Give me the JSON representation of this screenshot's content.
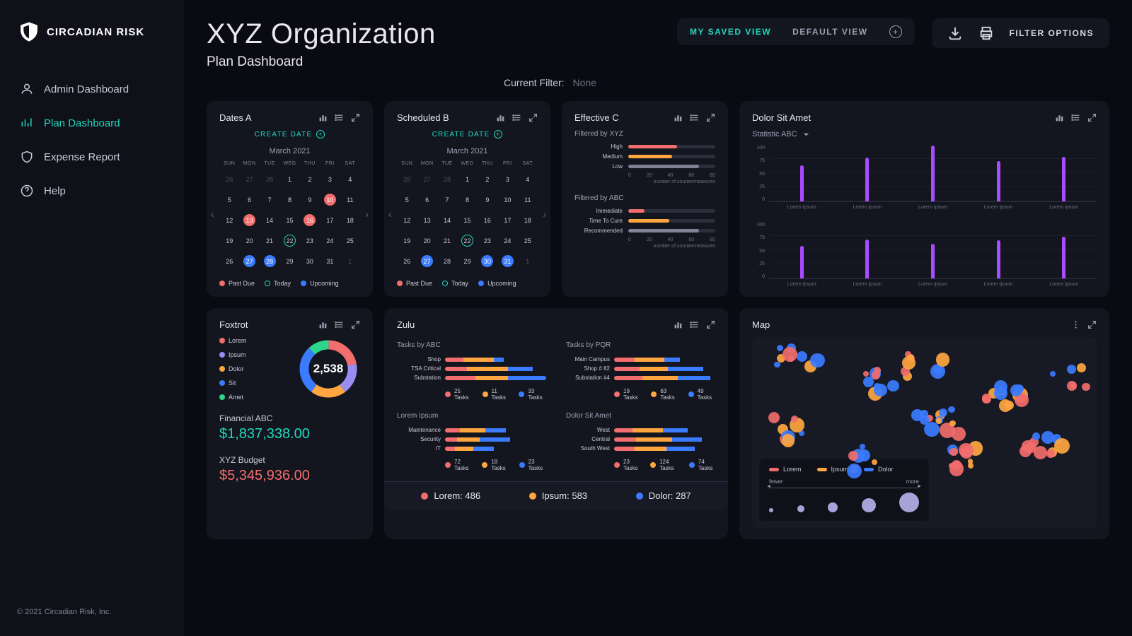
{
  "brand": {
    "name": "CIRCADIAN RISK",
    "copyright": "© 2021 Circadian Risk, Inc."
  },
  "sidebar": {
    "items": [
      {
        "label": "Admin Dashboard",
        "icon": "user-icon"
      },
      {
        "label": "Plan Dashboard",
        "icon": "bars-icon",
        "active": true
      },
      {
        "label": "Expense Report",
        "icon": "shield-icon"
      },
      {
        "label": "Help",
        "icon": "question-icon"
      }
    ]
  },
  "header": {
    "title": "XYZ Organization",
    "subtitle": "Plan Dashboard",
    "view_tabs": [
      "MY SAVED VIEW",
      "DEFAULT VIEW"
    ],
    "filter_options": "FILTER OPTIONS",
    "current_filter_label": "Current Filter:",
    "current_filter_value": "None"
  },
  "cards": {
    "datesA": {
      "title": "Dates A",
      "create": "CREATE DATE",
      "month": "March 2021",
      "dow": [
        "SUN",
        "MON",
        "TUE",
        "WED",
        "THU",
        "FRI",
        "SAT"
      ],
      "legend": {
        "pastdue": "Past Due",
        "today": "Today",
        "upcoming": "Upcoming"
      }
    },
    "scheduledB": {
      "title": "Scheduled B",
      "create": "CREATE DATE",
      "month": "March 2021"
    },
    "effectiveC": {
      "title": "Effective C",
      "section1_label": "Filtered by XYZ",
      "section2_label": "Filtered by ABC",
      "axis_label": "number of countermeasures"
    },
    "dolor": {
      "title": "Dolor Sit Amet",
      "dropdown": "Statistic ABC"
    },
    "foxtrot": {
      "title": "Foxtrot",
      "legend": [
        "Lorem",
        "Ipsum",
        "Dolor",
        "Sit",
        "Amet"
      ],
      "center_value": "2,538",
      "fin1_label": "Financial ABC",
      "fin1_value": "$1,837,338.00",
      "fin2_label": "XYZ Budget",
      "fin2_value": "$5,345,936.00"
    },
    "zulu": {
      "title": "Zulu",
      "sections": {
        "tasks_abc": {
          "label": "Tasks by ABC",
          "legend": [
            "25 Tasks",
            "11 Tasks",
            "33 Tasks"
          ]
        },
        "tasks_pqr": {
          "label": "Tasks by PQR",
          "legend": [
            "19 Tasks",
            "63 Tasks",
            "49 Tasks"
          ]
        },
        "lorem": {
          "label": "Lorem Ipsum",
          "legend": [
            "72 Tasks",
            "18 Tasks",
            "23 Tasks"
          ]
        },
        "dolor": {
          "label": "Dolor Sit Amet",
          "legend": [
            "23 Tasks",
            "124 Tasks",
            "74 Tasks"
          ]
        }
      },
      "footer": {
        "lorem": "Lorem: 486",
        "ipsum": "Ipsum: 583",
        "dolor": "Dolor: 287"
      }
    },
    "map": {
      "title": "Map",
      "legend": [
        "Lorem",
        "Ipsum",
        "Dolor"
      ],
      "scale": {
        "fewer": "fewer",
        "more": "more"
      }
    }
  },
  "colors": {
    "teal": "#1fd8c0",
    "red": "#f26d6d",
    "blue": "#3a7bff",
    "orange": "#ffa640",
    "purple": "#a94bff",
    "grey": "#7f8294",
    "green": "#2dd68a",
    "violet": "#9b8cf0"
  },
  "chart_data": {
    "effectiveC_xyz": {
      "type": "bar",
      "orientation": "horizontal",
      "categories": [
        "High",
        "Medium",
        "Low"
      ],
      "values": [
        45,
        40,
        65
      ],
      "colors": [
        "#f26d6d",
        "#ffa640",
        "#7f8294"
      ],
      "xlim": [
        0,
        80
      ],
      "xticks": [
        0,
        20,
        40,
        60,
        80
      ],
      "xlabel": "number of countermeasures"
    },
    "effectiveC_abc": {
      "type": "bar",
      "orientation": "horizontal",
      "categories": [
        "Immediate",
        "Time To Cure",
        "Recommended"
      ],
      "values": [
        15,
        38,
        65
      ],
      "colors": [
        "#f26d6d",
        "#ffa640",
        "#7f8294"
      ],
      "xlim": [
        0,
        80
      ],
      "xticks": [
        0,
        20,
        40,
        60,
        80
      ],
      "xlabel": "number of countermeasures"
    },
    "dolor_top": {
      "type": "bar",
      "categories": [
        "Lorem Ipsum",
        "Lorem Ipsum",
        "Lorem Ipsum",
        "Lorem Ipsum",
        "Lorem Ipsum"
      ],
      "values": [
        65,
        78,
        100,
        72,
        80
      ],
      "ylim": [
        0,
        100
      ],
      "yticks": [
        0,
        25,
        50,
        75,
        100
      ],
      "color": "#a94bff"
    },
    "dolor_bottom": {
      "type": "bar",
      "categories": [
        "Lorem Ipsum",
        "Lorem Ipsum",
        "Lorem Ipsum",
        "Lorem Ipsum",
        "Lorem Ipsum"
      ],
      "values": [
        58,
        70,
        62,
        68,
        75
      ],
      "ylim": [
        0,
        100
      ],
      "yticks": [
        0,
        25,
        50,
        75,
        100
      ],
      "color": "#a94bff"
    },
    "foxtrot_donut": {
      "type": "pie",
      "series": [
        {
          "name": "Lorem",
          "value": 22,
          "color": "#f26d6d"
        },
        {
          "name": "Ipsum",
          "value": 18,
          "color": "#9b8cf0"
        },
        {
          "name": "Dolor",
          "value": 20,
          "color": "#ffa640"
        },
        {
          "name": "Sit",
          "value": 28,
          "color": "#3a7bff"
        },
        {
          "name": "Amet",
          "value": 12,
          "color": "#2dd68a"
        }
      ],
      "center_value": "2,538"
    },
    "zulu_tasks_abc": {
      "type": "bar",
      "stacked": true,
      "categories": [
        "Shop",
        "TSA Critical",
        "Substation"
      ],
      "series": [
        {
          "name": "25 Tasks",
          "color": "#f26d6d",
          "values": [
            18,
            22,
            30
          ]
        },
        {
          "name": "11 Tasks",
          "color": "#ffa640",
          "values": [
            30,
            40,
            32
          ]
        },
        {
          "name": "33 Tasks",
          "color": "#3a7bff",
          "values": [
            10,
            25,
            38
          ]
        }
      ]
    },
    "zulu_tasks_pqr": {
      "type": "bar",
      "stacked": true,
      "categories": [
        "Main Campus",
        "Shop # 82",
        "Substation #4"
      ],
      "series": [
        {
          "name": "19 Tasks",
          "color": "#f26d6d",
          "values": [
            20,
            25,
            28
          ]
        },
        {
          "name": "63 Tasks",
          "color": "#ffa640",
          "values": [
            30,
            28,
            35
          ]
        },
        {
          "name": "49 Tasks",
          "color": "#3a7bff",
          "values": [
            15,
            35,
            32
          ]
        }
      ]
    },
    "zulu_lorem": {
      "type": "bar",
      "stacked": true,
      "categories": [
        "Maintenance",
        "Security",
        "IT"
      ],
      "series": [
        {
          "name": "72 Tasks",
          "color": "#f26d6d",
          "values": [
            15,
            12,
            10
          ]
        },
        {
          "name": "18 Tasks",
          "color": "#ffa640",
          "values": [
            25,
            22,
            18
          ]
        },
        {
          "name": "23 Tasks",
          "color": "#3a7bff",
          "values": [
            20,
            30,
            20
          ]
        }
      ]
    },
    "zulu_dolor": {
      "type": "bar",
      "stacked": true,
      "categories": [
        "West",
        "Central",
        "South West"
      ],
      "series": [
        {
          "name": "23 Tasks",
          "color": "#f26d6d",
          "values": [
            18,
            22,
            20
          ]
        },
        {
          "name": "124 Tasks",
          "color": "#ffa640",
          "values": [
            30,
            35,
            32
          ]
        },
        {
          "name": "74 Tasks",
          "color": "#3a7bff",
          "values": [
            25,
            30,
            28
          ]
        }
      ]
    },
    "zulu_totals": {
      "Lorem": 486,
      "Ipsum": 583,
      "Dolor": 287
    }
  },
  "calendars": {
    "A": {
      "leading": [
        26,
        27,
        28
      ],
      "days_in_month": 31,
      "trailing": [
        1
      ],
      "marks": {
        "pastdue": [
          10,
          13,
          16
        ],
        "today": [
          22
        ],
        "upcoming": [
          27,
          28
        ]
      }
    },
    "B": {
      "leading": [
        26,
        27,
        28
      ],
      "days_in_month": 31,
      "trailing": [
        1
      ],
      "marks": {
        "pastdue": [],
        "today": [
          22
        ],
        "upcoming": [
          27,
          30,
          31
        ]
      }
    }
  }
}
